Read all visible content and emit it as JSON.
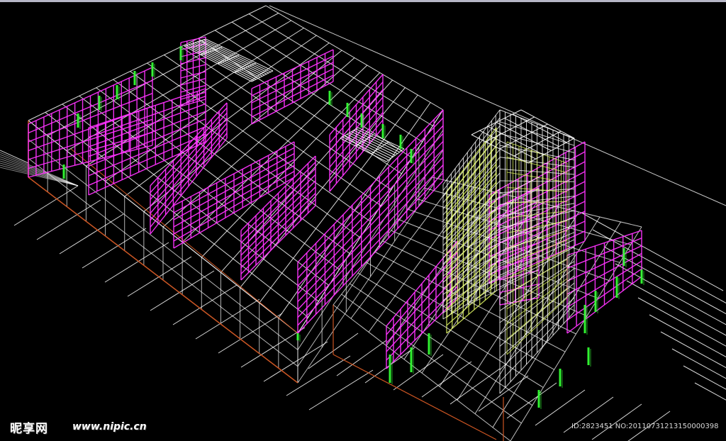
{
  "watermark": {
    "logo_text": "昵享网",
    "url_text": "www.nipic.cn",
    "id_text": "ID:2823451 NO:20110731213150000398"
  },
  "colors": {
    "background": "#000000",
    "frame": "#ffffff",
    "wall_panel": "#ff33ff",
    "column": "#33ff33",
    "tower_accent": "#e8ff66",
    "base_edge": "#cc5522"
  }
}
